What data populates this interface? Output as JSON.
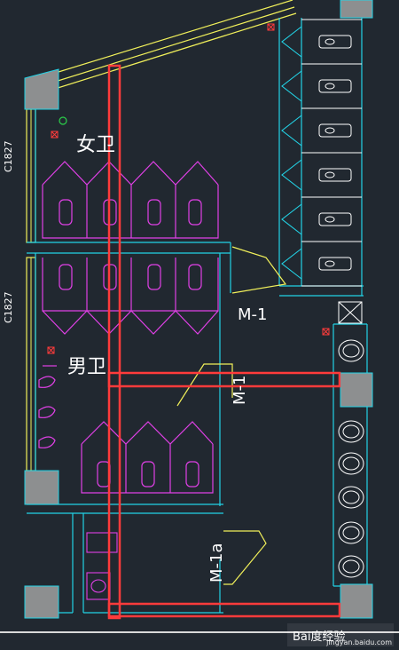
{
  "labels": {
    "window_c1827_top": "C1827",
    "window_c1827_bottom": "C1827",
    "womens_restroom": "女卫",
    "mens_restroom": "男卫",
    "door_m1_right": "M-1",
    "door_m1_vertical": "M-1",
    "door_m1a": "M-1a"
  },
  "watermark": {
    "logo_text": "Bai度经验",
    "url_text": "jingyan.baidu.com"
  },
  "colors": {
    "background": "#212830",
    "walls_cyan": "#22d3e6",
    "fixtures_magenta": "#e040e6",
    "highlight_red": "#ff3b3b",
    "yellow": "#f1f05a",
    "columns_gray": "#8d8f90",
    "green": "#2bd14a",
    "white": "#ffffff"
  }
}
